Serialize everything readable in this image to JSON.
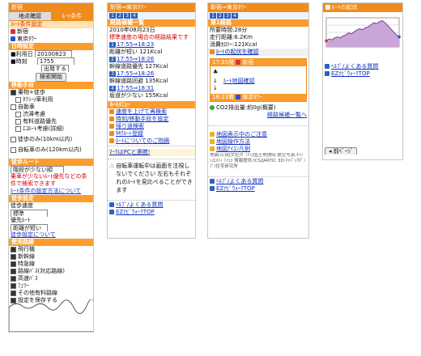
{
  "s1": {
    "header": "新宿",
    "tabs": [
      "地点確認",
      "ﾙｰﾄ条件"
    ],
    "sec_route": "ﾙｰﾄ条件設定",
    "from_icon": "出",
    "from": "新宿",
    "to_icon": "着",
    "to": "東京ﾀﾜｰ",
    "sec_date": "日時設定",
    "date_label": "■利用日",
    "date_value": "20100823",
    "time_label": "■時刻",
    "time_value": "1755",
    "depart_value": "出発する",
    "search_button": "検索開始",
    "sec_mode": "移動手段",
    "mode_items": [
      "乗物+徒歩",
      "ﾀｸｼｰ/車利用",
      "自動車",
      "渋滞考慮",
      "有料道路優先",
      "ｴｺﾙｰﾄ考慮(詳細)",
      "徒歩のみ(10km以内)",
      "自転車のみ(120km以内)"
    ],
    "sec_walk": "徒歩ルート",
    "walk_options": [
      "階段が少ない順",
      "乗車が少ないﾙｰﾄ優先などの条件で検索できます",
      "ﾙｰﾄ条件の設定方法について"
    ],
    "sec_speed": "徒歩設定",
    "walk_speed_label": "徒歩速度",
    "walk_speed": "標準",
    "priority_label": "優先ﾙｰﾄ",
    "priority": "距離が短い",
    "walk_link": "徒歩設定について",
    "sec_use": "使用路線",
    "use_items": [
      "飛行機",
      "新幹線",
      "特急線",
      "路線ﾊﾞｽ(対応路線)",
      "高速ﾊﾞｽ",
      "ﾌｪﾘｰ",
      "その他有料路線"
    ],
    "save_label": "設定を保存する"
  },
  "s2": {
    "header": "新宿⇒東京ﾀﾜｰ",
    "tabs": [
      "1",
      "2",
      "3",
      "4"
    ],
    "sec_list": "経路候補一覧",
    "date": "2010年08月23日",
    "note": "標準速度の場合の経路結果です",
    "results": [
      {
        "no": "1",
        "time": "17:55⇒18:23",
        "desc": "距離が短い 121Kcal"
      },
      {
        "no": "2",
        "time": "17:55⇒18:26",
        "desc": "幹線道路優先 127Kcal"
      },
      {
        "no": "3",
        "time": "17:55⇒18:26",
        "desc": "幹線道路回避 135Kcal"
      },
      {
        "no": "4",
        "time": "17:55⇒18:31",
        "desc": "坂道が少ない 155Kcal"
      }
    ],
    "sec_menu": "ﾙｰﾄﾒﾆｭｰ",
    "menu_items": [
      "速度を上げて再検索",
      "時刻/移動手段を設定",
      "帰り道検索",
      "Mｸﾙｰﾄ登録",
      "ﾙｰﾄについてのご指摘"
    ],
    "pc_link": "ﾏｰｸはPCと連携!",
    "warning": "自転車運転中は画面を注視しないでください 左右もそれぞれのﾙｰﾄを見比べることができます",
    "help_link": "ﾍﾙﾌﾟ/よくある質問",
    "top_link": "EZﾅﾋﾞｳｫｰｸTOP"
  },
  "s3": {
    "header": "新宿⇒東京ﾀﾜｰ",
    "tabs": [
      "1",
      "2",
      "3",
      "4"
    ],
    "sec_route": "第1経路",
    "time_label": "所要時間",
    "time": "28分",
    "dist_label": "走行距離",
    "dist": "6.2Km",
    "cal_label": "消費ｶﾛﾘｰ",
    "cal": "121Kcal",
    "elev_link": "ﾙｰﾄの起伏を確認",
    "start_time": "17:55発",
    "start": "新宿",
    "map_link": "ﾙｰﾄ地図確認",
    "end_time": "18:23着",
    "end": "東京ﾀﾜｰ",
    "co2": "CO2排出量:約0g(概要)",
    "list_link": "経路候補一覧へ",
    "notes": [
      "地図表示中のご注意",
      "地図操作方法",
      "地図ｱｲｺﾝ凡例"
    ],
    "credits": "地図:(c)昭文社/ｾﾞﾝﾘﾝ/国土地理院 航空写真:ｷｬﾉﾝ/ｴｽﾃｨ ﾗﾌｪｽ 情報提供:ICS/JARTIC 3D:ｷｬﾊﾞｯｸﾎﾟﾝﾌﾟ/住宅研究所",
    "help_link": "ﾍﾙﾌﾟ/よくある質問",
    "top_link": "EZﾅﾋﾞｳｫｰｸTOP"
  },
  "s4": {
    "header": "ﾙｰﾄの起伏",
    "elevation": [
      6,
      8,
      7,
      9,
      10,
      9,
      11,
      12,
      14,
      13,
      15,
      17,
      18,
      17,
      19,
      20,
      22,
      24,
      23,
      25,
      26,
      24,
      21,
      18,
      15,
      12,
      10
    ],
    "help_link": "ﾍﾙﾌﾟ/よくある質問",
    "top_link": "EZﾅﾋﾞｳｫｰｸTOP",
    "prev_button": "前ﾍﾟｰｼﾞ"
  },
  "colors": {
    "accent": "#f08c1e",
    "bar": "#fb9c2d",
    "link": "#1030c0",
    "alert": "#d40000"
  }
}
